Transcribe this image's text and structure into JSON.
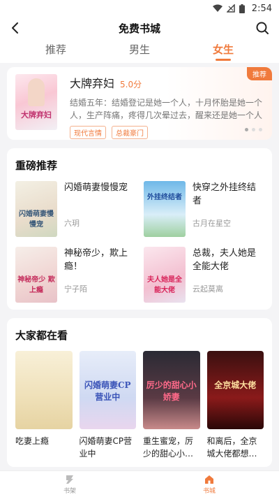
{
  "status": {
    "time": "2:54"
  },
  "header": {
    "title": "免费书城"
  },
  "tabs": [
    {
      "label": "推荐",
      "active": false
    },
    {
      "label": "男生",
      "active": false
    },
    {
      "label": "女生",
      "active": true
    }
  ],
  "hero": {
    "name": "大牌弃妇",
    "score": "5.0分",
    "desc": "结婚五年：结婚登记是她一个人，十月怀胎是她一个人，生产阵痛，疼得几次晕过去，醒来还是她一个人",
    "tags": [
      "现代言情",
      "总裁豪门"
    ],
    "badge": "推荐",
    "cover_text": "大牌弃妇"
  },
  "featured": {
    "title": "重磅推荐",
    "books": [
      {
        "title": "闪婚萌妻慢慢宠",
        "author": "六玥",
        "cover_text": "闪婚萌妻慢慢宠"
      },
      {
        "title": "快穿之外挂终结者",
        "author": "古月在星空",
        "cover_text": "外挂终结者"
      },
      {
        "title": "神秘帝少，欺上瘾！",
        "author": "宁子陌",
        "cover_text": "神秘帝少 欺上瘾"
      },
      {
        "title": "总裁，夫人她是全能大佬",
        "author": "云起莫离",
        "cover_text": "夫人她是全能大佬"
      }
    ]
  },
  "popular": {
    "title": "大家都在看",
    "books": [
      {
        "title": "吃妻上瘾",
        "cover_text": ""
      },
      {
        "title": "闪婚萌妻CP营业中",
        "cover_text": "闪婚萌妻CP营业中"
      },
      {
        "title": "重生蜜宠，厉少的甜心小…",
        "cover_text": "厉少的甜心小娇妻"
      },
      {
        "title": "和离后，全京城大佬都想…",
        "cover_text": "全京城大佬"
      }
    ]
  },
  "bottom_nav": [
    {
      "label": "书架",
      "active": false
    },
    {
      "label": "书城",
      "active": true
    }
  ],
  "colors": {
    "accent": "#f07a3c"
  }
}
